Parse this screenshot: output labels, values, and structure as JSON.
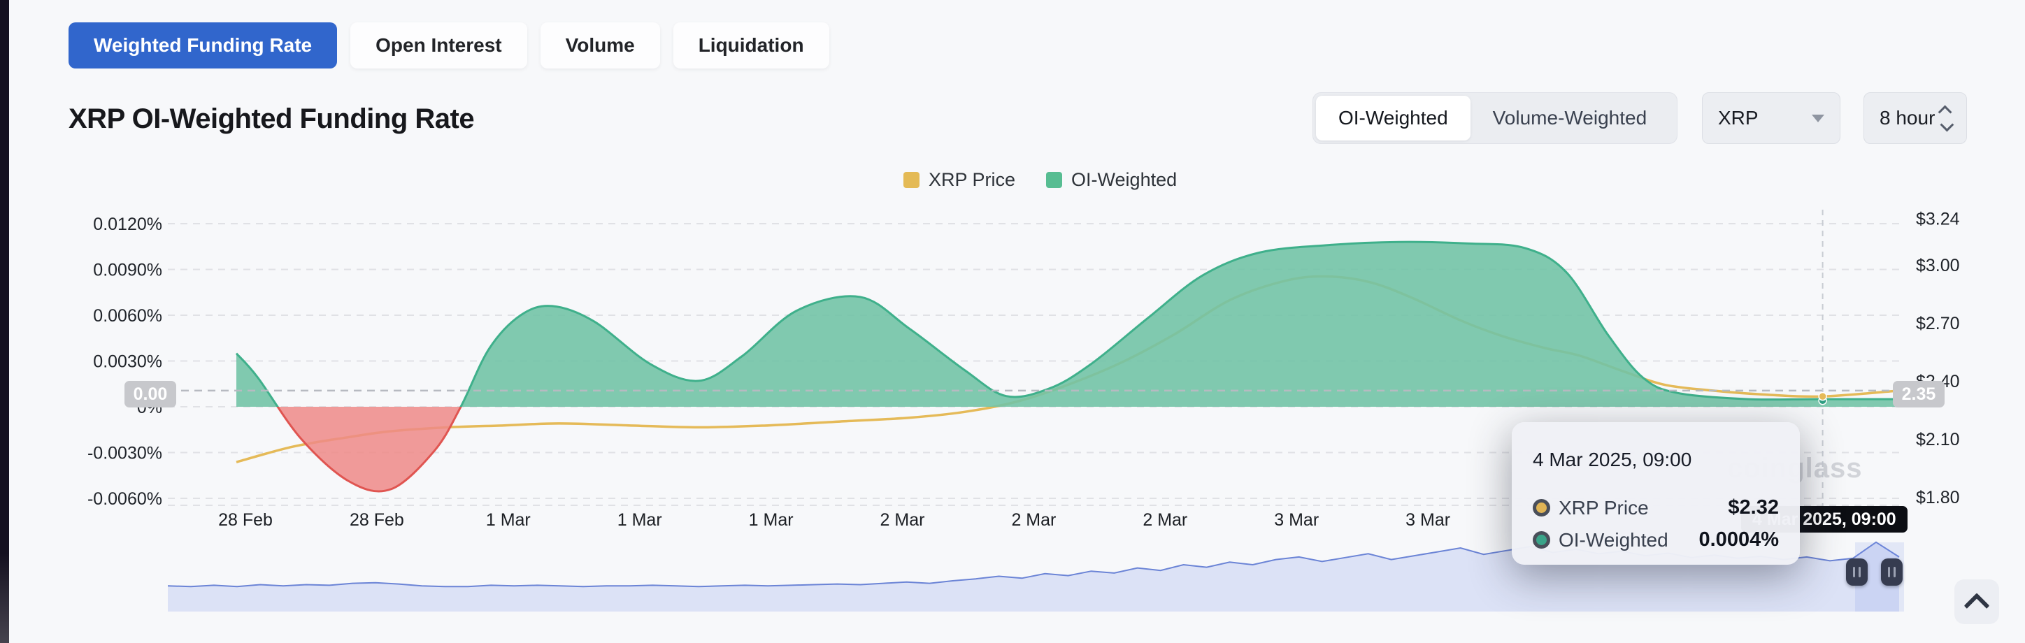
{
  "app": {
    "watermark": "coinglass"
  },
  "tabs": [
    {
      "label": "Weighted Funding Rate",
      "active": true
    },
    {
      "label": "Open Interest",
      "active": false
    },
    {
      "label": "Volume",
      "active": false
    },
    {
      "label": "Liquidation",
      "active": false
    }
  ],
  "header": {
    "title": "XRP OI-Weighted Funding Rate"
  },
  "controls": {
    "weight_toggle": {
      "options": [
        "OI-Weighted",
        "Volume-Weighted"
      ],
      "selected": "OI-Weighted"
    },
    "symbol_select": {
      "value": "XRP"
    },
    "interval_select": {
      "value": "8 hour"
    }
  },
  "legend": [
    {
      "label": "XRP Price",
      "color": "#e4ba55"
    },
    {
      "label": "OI-Weighted",
      "color": "#57bd92"
    }
  ],
  "crosshair": {
    "date_label": "4 Mar 2025, 09:00",
    "left_value": "0.00",
    "right_value": "2.35"
  },
  "tooltip": {
    "title": "4 Mar 2025, 09:00",
    "rows": [
      {
        "label": "XRP Price",
        "value": "$2.32",
        "marker_color": "#e0b455"
      },
      {
        "label": "OI-Weighted",
        "value": "0.0004%",
        "marker_color": "#3aa489"
      }
    ]
  },
  "chart_data": {
    "type": "area+line",
    "title": "XRP OI-Weighted Funding Rate",
    "x_ticks": [
      "28 Feb",
      "28 Feb",
      "1 Mar",
      "1 Mar",
      "1 Mar",
      "2 Mar",
      "2 Mar",
      "2 Mar",
      "3 Mar",
      "3 Mar"
    ],
    "crosshair_label": "4 Mar 2025, 09:00",
    "crosshair_fraction": 0.954,
    "left_axis": {
      "unit": "%",
      "ticks": [
        0.012,
        0.009,
        0.006,
        0.003,
        0,
        -0.003,
        -0.006
      ],
      "zero_label": "0%"
    },
    "right_axis": {
      "unit": "$",
      "ticks": [
        3.24,
        3.0,
        2.7,
        2.4,
        2.1,
        1.8
      ]
    },
    "current_price_line": 2.35,
    "series": [
      {
        "name": "OI-Weighted",
        "type": "area",
        "axis": "left",
        "unit": "%",
        "positive_color": "#72c3a6",
        "negative_color": "#ee8987",
        "positive_line": "#3fb08b",
        "negative_line": "#e05551",
        "points": [
          [
            0,
            0.0035
          ],
          [
            0.013,
            0.0019
          ],
          [
            0.039,
            -0.0021
          ],
          [
            0.068,
            -0.0049
          ],
          [
            0.093,
            -0.0054
          ],
          [
            0.119,
            -0.0029
          ],
          [
            0.135,
            0
          ],
          [
            0.152,
            0.0038
          ],
          [
            0.171,
            0.006
          ],
          [
            0.19,
            0.0066
          ],
          [
            0.215,
            0.0056
          ],
          [
            0.249,
            0.0028
          ],
          [
            0.278,
            0.0017
          ],
          [
            0.304,
            0.0033
          ],
          [
            0.337,
            0.0063
          ],
          [
            0.375,
            0.0072
          ],
          [
            0.405,
            0.0051
          ],
          [
            0.438,
            0.0024
          ],
          [
            0.463,
            0.0007
          ],
          [
            0.489,
            0.0012
          ],
          [
            0.514,
            0.0028
          ],
          [
            0.548,
            0.0058
          ],
          [
            0.581,
            0.0086
          ],
          [
            0.615,
            0.0101
          ],
          [
            0.657,
            0.0106
          ],
          [
            0.699,
            0.0108
          ],
          [
            0.741,
            0.0107
          ],
          [
            0.775,
            0.0104
          ],
          [
            0.8,
            0.0088
          ],
          [
            0.825,
            0.0047
          ],
          [
            0.846,
            0.0019
          ],
          [
            0.867,
            0.0009
          ],
          [
            0.909,
            0.0005
          ],
          [
            0.951,
            0.0005
          ],
          [
            1,
            0.0005
          ]
        ],
        "last_value": 0.0004
      },
      {
        "name": "XRP Price",
        "type": "line",
        "axis": "right",
        "unit": "$",
        "color": "#e5ba58",
        "points": [
          [
            0,
            1.98
          ],
          [
            0.034,
            2.06
          ],
          [
            0.068,
            2.11
          ],
          [
            0.093,
            2.14
          ],
          [
            0.127,
            2.16
          ],
          [
            0.161,
            2.17
          ],
          [
            0.194,
            2.18
          ],
          [
            0.236,
            2.17
          ],
          [
            0.278,
            2.16
          ],
          [
            0.32,
            2.17
          ],
          [
            0.363,
            2.19
          ],
          [
            0.405,
            2.21
          ],
          [
            0.438,
            2.24
          ],
          [
            0.468,
            2.29
          ],
          [
            0.497,
            2.37
          ],
          [
            0.531,
            2.49
          ],
          [
            0.564,
            2.64
          ],
          [
            0.598,
            2.82
          ],
          [
            0.632,
            2.92
          ],
          [
            0.657,
            2.94
          ],
          [
            0.682,
            2.91
          ],
          [
            0.707,
            2.83
          ],
          [
            0.737,
            2.71
          ],
          [
            0.762,
            2.63
          ],
          [
            0.787,
            2.57
          ],
          [
            0.808,
            2.53
          ],
          [
            0.834,
            2.45
          ],
          [
            0.859,
            2.38
          ],
          [
            0.888,
            2.35
          ],
          [
            0.918,
            2.33
          ],
          [
            0.954,
            2.32
          ],
          [
            1,
            2.35
          ]
        ],
        "last_value": 2.32
      }
    ],
    "navigator": {
      "line_color": "#6b84d6",
      "fill_color": "#dce2f6",
      "values": [
        0.29,
        0.28,
        0.3,
        0.28,
        0.31,
        0.29,
        0.31,
        0.3,
        0.33,
        0.34,
        0.32,
        0.29,
        0.28,
        0.28,
        0.3,
        0.29,
        0.3,
        0.29,
        0.28,
        0.29,
        0.29,
        0.3,
        0.29,
        0.28,
        0.29,
        0.3,
        0.29,
        0.3,
        0.31,
        0.32,
        0.31,
        0.33,
        0.35,
        0.33,
        0.37,
        0.4,
        0.44,
        0.41,
        0.48,
        0.45,
        0.52,
        0.49,
        0.57,
        0.53,
        0.62,
        0.58,
        0.66,
        0.62,
        0.7,
        0.74,
        0.67,
        0.73,
        0.79,
        0.7,
        0.76,
        0.82,
        0.88,
        0.78,
        0.84,
        0.9,
        0.81,
        0.86,
        0.79,
        0.83,
        0.76,
        0.8,
        0.73,
        0.77,
        0.72,
        0.75,
        0.7,
        0.74,
        0.68,
        0.72,
        0.97,
        0.74
      ]
    }
  }
}
